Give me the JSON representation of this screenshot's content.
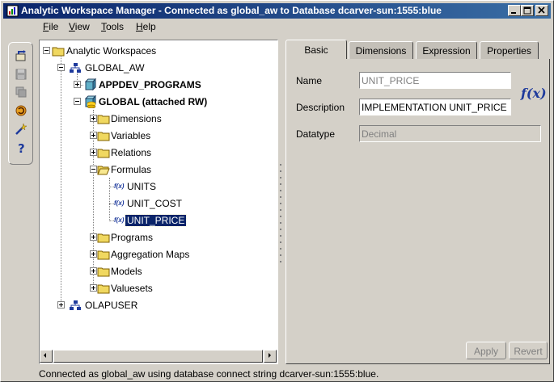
{
  "window": {
    "title": "Analytic Workspace Manager - Connected as global_aw to Database dcarver-sun:1555:blue"
  },
  "menu": [
    {
      "key": "F",
      "rest": "ile"
    },
    {
      "key": "V",
      "rest": "iew"
    },
    {
      "key": "T",
      "rest": "ools"
    },
    {
      "key": "H",
      "rest": "elp"
    }
  ],
  "toolbar": [
    "connect-icon",
    "save-icon",
    "copy-icon",
    "refresh-icon",
    "wizard-icon",
    "help-icon"
  ],
  "tree": {
    "root": "Analytic Workspaces",
    "global_aw": "GLOBAL_AW",
    "appdev": "APPDEV_PROGRAMS",
    "global": "GLOBAL (attached RW)",
    "dimensions": "Dimensions",
    "variables": "Variables",
    "relations": "Relations",
    "formulas": "Formulas",
    "units": "UNITS",
    "unit_cost": "UNIT_COST",
    "unit_price": "UNIT_PRICE",
    "programs": "Programs",
    "aggregation_maps": "Aggregation Maps",
    "models": "Models",
    "valuesets": "Valuesets",
    "olapuser": "OLAPUSER",
    "formula_icon_text": "f(x)"
  },
  "tabs": {
    "basic": "Basic",
    "dimensions": "Dimensions",
    "expression": "Expression",
    "properties": "Properties"
  },
  "form": {
    "name_label": "Name",
    "name_value": "UNIT_PRICE",
    "description_label": "Description",
    "description_value": "IMPLEMENTATION UNIT_PRICE I",
    "datatype_label": "Datatype",
    "datatype_value": "Decimal",
    "fx_label": "f(x)"
  },
  "buttons": {
    "apply": "Apply",
    "revert": "Revert"
  },
  "status": "Connected as global_aw using database connect string dcarver-sun:1555:blue."
}
